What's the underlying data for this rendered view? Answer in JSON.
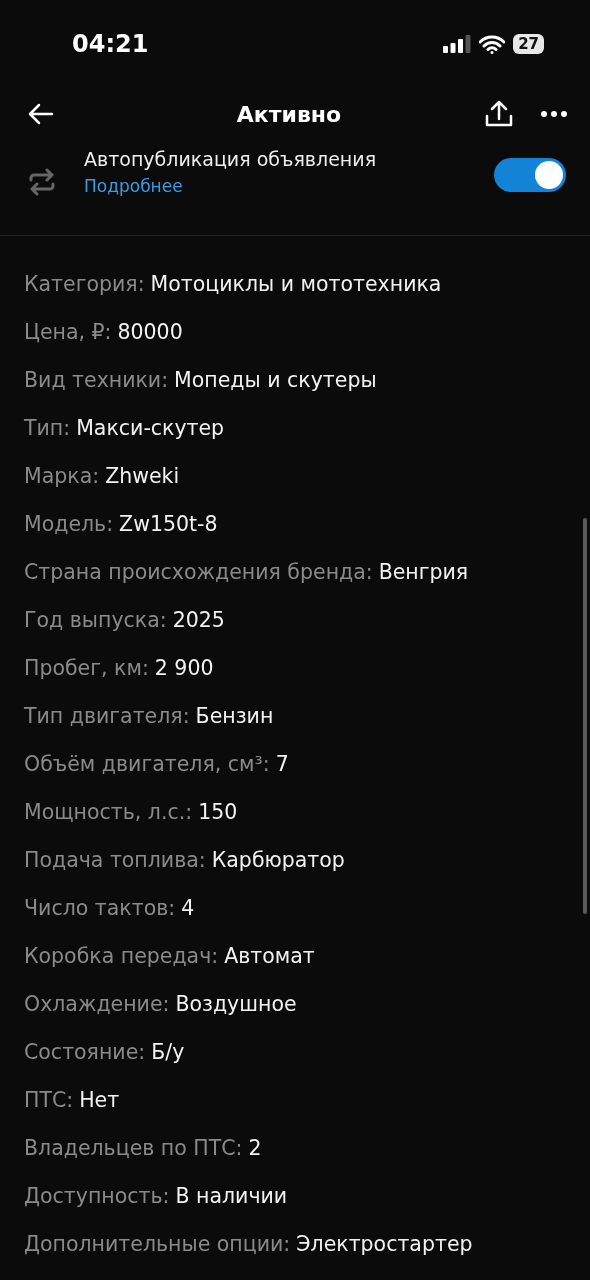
{
  "status_bar": {
    "time": "04:21",
    "battery": "27"
  },
  "nav": {
    "title": "Активно"
  },
  "autopublish": {
    "title": "Автопубликация объявления",
    "link": "Подробнее",
    "on": true
  },
  "specs": [
    {
      "label": "Категория:",
      "value": "Мотоциклы и мототехника"
    },
    {
      "label": "Цена, ₽:",
      "value": "80000"
    },
    {
      "label": "Вид техники:",
      "value": "Мопеды и скутеры"
    },
    {
      "label": "Тип:",
      "value": "Макси-скутер"
    },
    {
      "label": "Марка:",
      "value": "Zhweki"
    },
    {
      "label": "Модель:",
      "value": "Zw150t-8"
    },
    {
      "label": "Страна происхождения бренда:",
      "value": "Венгрия"
    },
    {
      "label": "Год выпуска:",
      "value": "2025"
    },
    {
      "label": "Пробег, км:",
      "value": "2 900"
    },
    {
      "label": "Тип двигателя:",
      "value": "Бензин"
    },
    {
      "label": "Объём двигателя, см³:",
      "value": "7"
    },
    {
      "label": "Мощность, л.с.:",
      "value": "150"
    },
    {
      "label": "Подача топлива:",
      "value": "Карбюратор"
    },
    {
      "label": "Число тактов:",
      "value": "4"
    },
    {
      "label": "Коробка передач:",
      "value": "Автомат"
    },
    {
      "label": "Охлаждение:",
      "value": "Воздушное"
    },
    {
      "label": "Состояние:",
      "value": "Б/у"
    },
    {
      "label": "ПТС:",
      "value": "Нет"
    },
    {
      "label": "Владельцев по ПТС:",
      "value": "2"
    },
    {
      "label": "Доступность:",
      "value": "В наличии"
    },
    {
      "label": "Дополнительные опции:",
      "value": "Электростартер"
    }
  ]
}
